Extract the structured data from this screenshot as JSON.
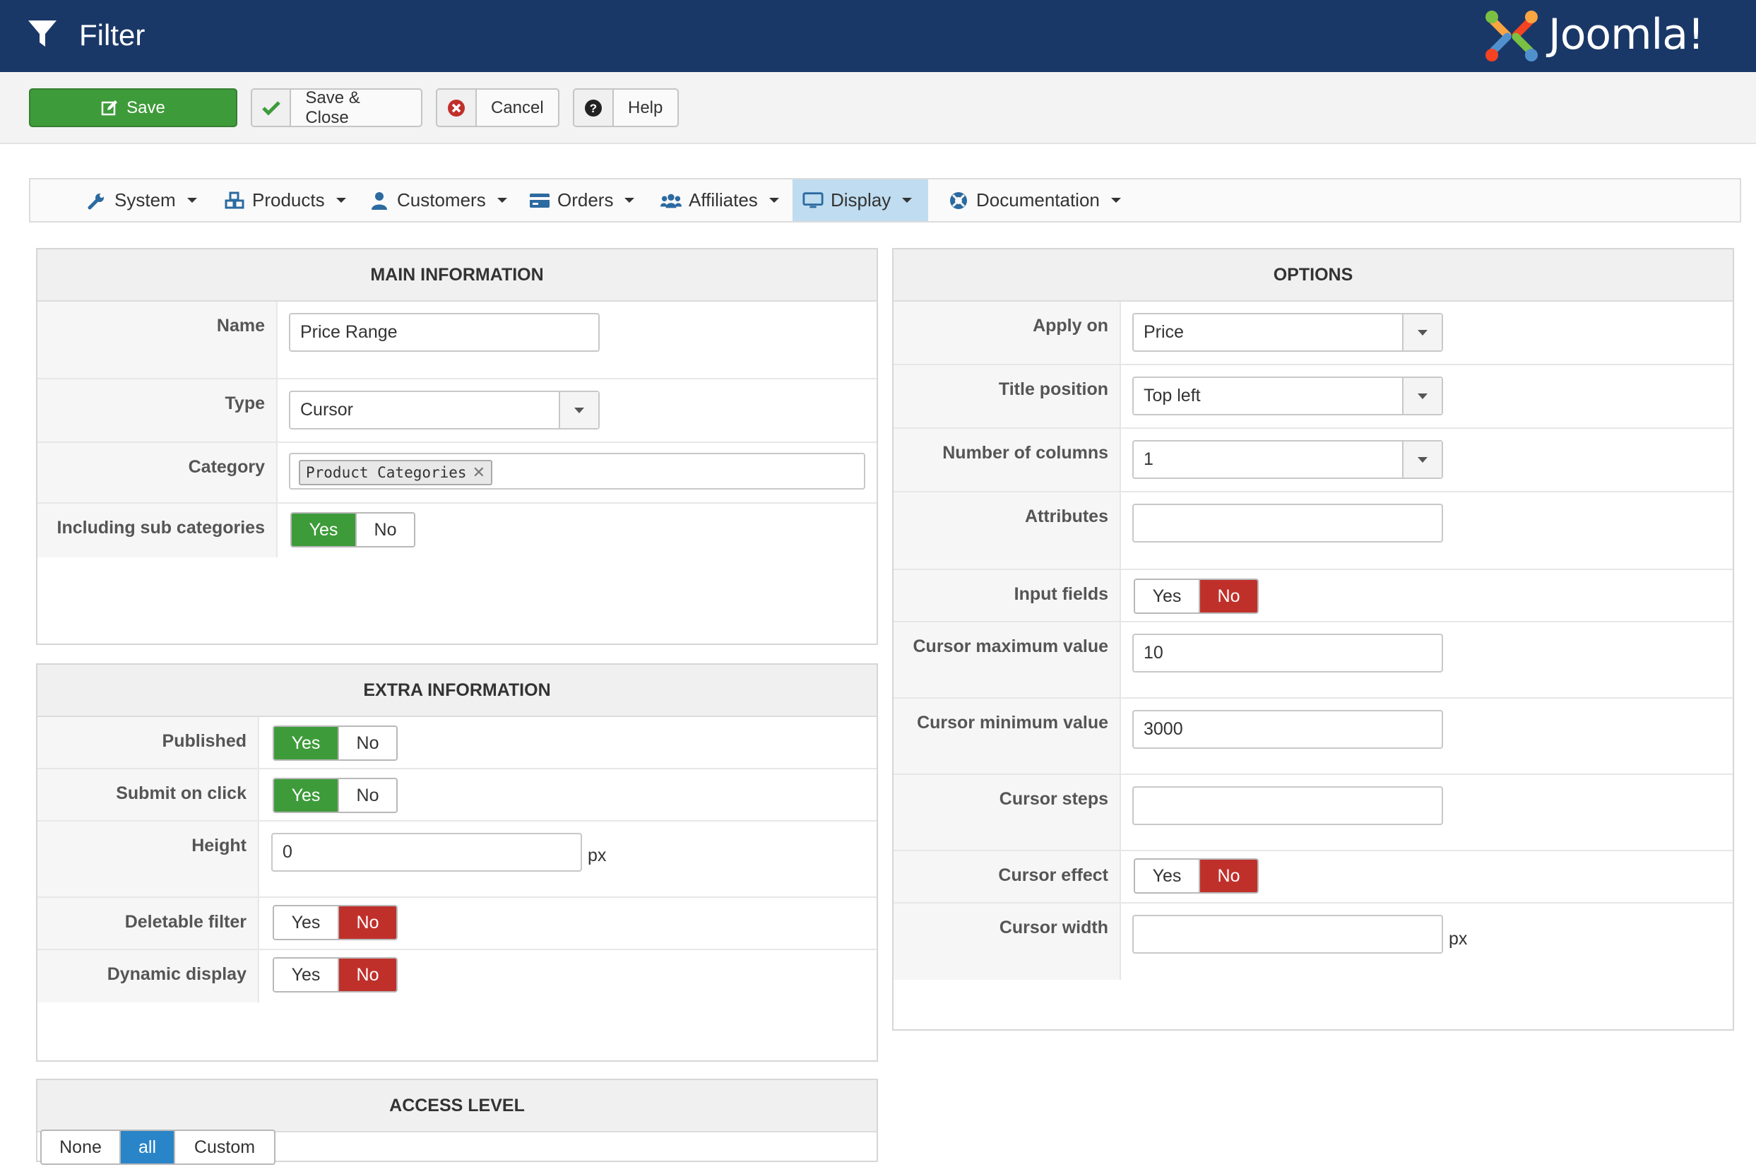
{
  "header": {
    "title": "Filter",
    "logo_text": "Joomla!"
  },
  "toolbar": {
    "save": "Save",
    "save_close": "Save & Close",
    "cancel": "Cancel",
    "help": "Help"
  },
  "nav": {
    "items": [
      {
        "label": "System",
        "icon": "wrench-icon"
      },
      {
        "label": "Products",
        "icon": "cubes-icon"
      },
      {
        "label": "Customers",
        "icon": "user-icon"
      },
      {
        "label": "Orders",
        "icon": "credit-card-icon"
      },
      {
        "label": "Affiliates",
        "icon": "users-icon"
      },
      {
        "label": "Display",
        "icon": "monitor-icon",
        "active": true
      },
      {
        "label": "Documentation",
        "icon": "life-ring-icon"
      }
    ]
  },
  "main_info": {
    "title": "MAIN INFORMATION",
    "name_label": "Name",
    "name_value": "Price Range",
    "type_label": "Type",
    "type_value": "Cursor",
    "category_label": "Category",
    "category_tag": "Product Categories",
    "sub_label": "Including sub categories",
    "sub_yes": "Yes",
    "sub_no": "No",
    "sub_selected": "Yes"
  },
  "extra_info": {
    "title": "EXTRA INFORMATION",
    "published_label": "Published",
    "published_selected": "Yes",
    "submit_label": "Submit on click",
    "submit_selected": "Yes",
    "height_label": "Height",
    "height_value": "0",
    "height_unit": "px",
    "deletable_label": "Deletable filter",
    "deletable_selected": "No",
    "dynamic_label": "Dynamic display",
    "dynamic_selected": "No",
    "yes": "Yes",
    "no": "No"
  },
  "access": {
    "title": "ACCESS LEVEL",
    "none": "None",
    "all": "all",
    "custom": "Custom",
    "selected": "all"
  },
  "options": {
    "title": "OPTIONS",
    "apply_label": "Apply on",
    "apply_value": "Price",
    "title_pos_label": "Title position",
    "title_pos_value": "Top left",
    "columns_label": "Number of columns",
    "columns_value": "1",
    "attributes_label": "Attributes",
    "attributes_value": "",
    "input_fields_label": "Input fields",
    "input_fields_selected": "No",
    "cursor_max_label": "Cursor maximum value",
    "cursor_max_value": "10",
    "cursor_min_label": "Cursor minimum value",
    "cursor_min_value": "3000",
    "cursor_steps_label": "Cursor steps",
    "cursor_steps_value": "",
    "cursor_effect_label": "Cursor effect",
    "cursor_effect_selected": "No",
    "cursor_width_label": "Cursor width",
    "cursor_width_value": "",
    "cursor_width_unit": "px",
    "yes": "Yes",
    "no": "No"
  },
  "colors": {
    "header_bg": "#1a3867",
    "save_green": "#3e9b3a",
    "toggle_red": "#c0302b",
    "toggle_blue": "#2a85c8",
    "active_tab": "#bfdcf0"
  }
}
